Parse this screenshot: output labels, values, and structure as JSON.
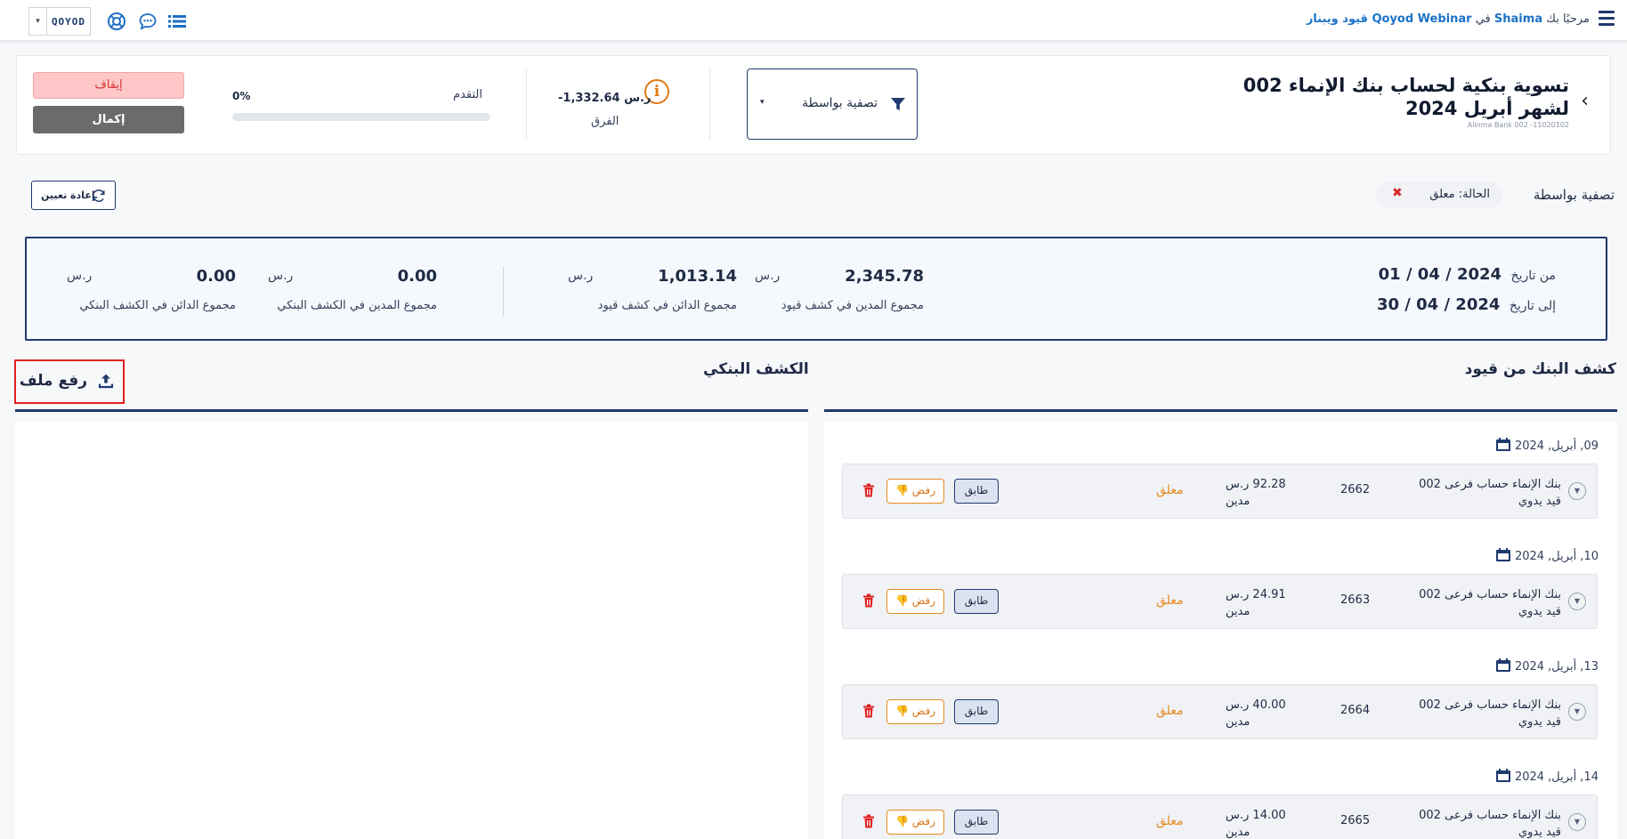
{
  "topbar": {
    "welcome_prefix": "مرحبًا بك",
    "user": "Shaima",
    "in_word": "في",
    "company": "Qoyod Webinar قيود ويبنار",
    "logo_text": "QOYOD",
    "dropdown_caret": "▾",
    "icons": [
      "hamburger-icon",
      "list-icon",
      "chat-icon",
      "support-icon"
    ]
  },
  "header": {
    "back": "‹",
    "title": "تسوية بنكية لحساب بنك الإنماء 002 لشهر أبريل 2024",
    "subtitle": "Alinma Bank 002 -11020102",
    "filter_label": "تصفية بواسطة",
    "filter_caret": "▾",
    "info": "i",
    "difference_value": "-1,332.64 ر.س",
    "difference_label": "الفرق",
    "progress_label": "التقدم",
    "progress_percent": "0%",
    "progress_value": 0,
    "stop_label": "إيقاف",
    "complete_label": "إكمال"
  },
  "filters": {
    "filter_by": "تصفية بواسطة",
    "chip_text": "الحالة: معلق",
    "chip_remove": "✖",
    "reset_label": "إعادة تعيين"
  },
  "summary": {
    "from_label": "من تاريخ",
    "from_value": "2024 / 04 / 01",
    "to_label": "إلى تاريخ",
    "to_value": "2024 / 04 / 30",
    "totals": [
      {
        "value": "2,345.78",
        "currency": "ر.س",
        "label": "مجموع المدين في كشف قيود"
      },
      {
        "value": "1,013.14",
        "currency": "ر.س",
        "label": "مجموع الدائن في كشف قيود"
      },
      {
        "value": "0.00",
        "currency": "ر.س",
        "label": "مجموع المدين في الكشف البنكي"
      },
      {
        "value": "0.00",
        "currency": "ر.س",
        "label": "مجموع الدائن في الكشف البنكي"
      }
    ]
  },
  "columns": {
    "qoyod_title": "كشف البنك من قيود",
    "bank_title": "الكشف البنكي",
    "upload_label": "رفع ملف"
  },
  "entries": [
    {
      "date": "09, أبريل, 2024",
      "account": "بنك الإنماء حساب فرعى 002",
      "type": "قيد يدوي",
      "number": "2662",
      "amount": "92.28 ر.س",
      "side": "مدين",
      "status": "معلق",
      "match": "طابق",
      "reject": "رفض"
    },
    {
      "date": "10, أبريل, 2024",
      "account": "بنك الإنماء حساب فرعى 002",
      "type": "قيد يدوي",
      "number": "2663",
      "amount": "24.91 ر.س",
      "side": "مدين",
      "status": "معلق",
      "match": "طابق",
      "reject": "رفض"
    },
    {
      "date": "13, أبريل, 2024",
      "account": "بنك الإنماء حساب فرعى 002",
      "type": "قيد يدوي",
      "number": "2664",
      "amount": "40.00 ر.س",
      "side": "مدين",
      "status": "معلق",
      "match": "طابق",
      "reject": "رفض"
    },
    {
      "date": "14, أبريل, 2024",
      "account": "بنك الإنماء حساب فرعى 002",
      "type": "قيد يدوي",
      "number": "2665",
      "amount": "14.00 ر.س",
      "side": "مدين",
      "status": "معلق",
      "match": "طابق",
      "reject": "رفض"
    }
  ],
  "colors": {
    "primary": "#1f3a6e",
    "accent_blue": "#1b72c9",
    "pending": "#e58a1f",
    "danger": "#d62828"
  }
}
